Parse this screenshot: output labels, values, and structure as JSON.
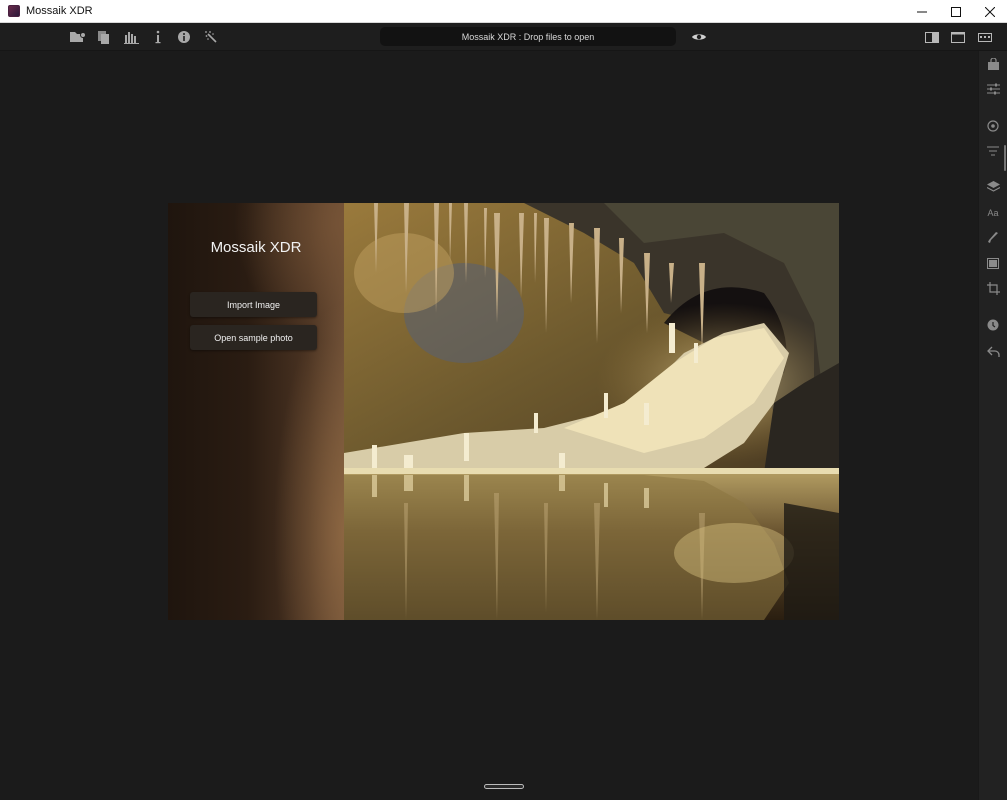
{
  "window": {
    "title": "Mossaik XDR",
    "controls": [
      "minimize-icon",
      "maximize-icon",
      "close-icon"
    ]
  },
  "toolbar": {
    "drop_text": "Mossaik XDR : Drop files to open",
    "left_icons": [
      "open-folder-icon",
      "copy-icon",
      "histogram-icon",
      "info-i-icon",
      "info-circle-icon",
      "magic-wand-icon"
    ],
    "preview_icon": "eye-icon",
    "right_icons": [
      "split-view-icon",
      "single-view-icon",
      "filmstrip-icon"
    ]
  },
  "right_panel": {
    "icons": [
      "bag-icon",
      "sliders-icon",
      "target-icon",
      "filter-lines-icon",
      "layers-icon",
      "text-icon",
      "brush-icon",
      "frame-icon",
      "crop-icon",
      "history-icon",
      "undo-icon"
    ],
    "text_tool_label": "Aa"
  },
  "welcome": {
    "app_name": "Mossaik XDR",
    "import_label": "Import Image",
    "sample_label": "Open sample photo"
  },
  "colors": {
    "background": "#1b1b1b",
    "toolbar": "#1e1e1e",
    "drop_bar": "#121212",
    "button_bg": "#2a2520"
  }
}
